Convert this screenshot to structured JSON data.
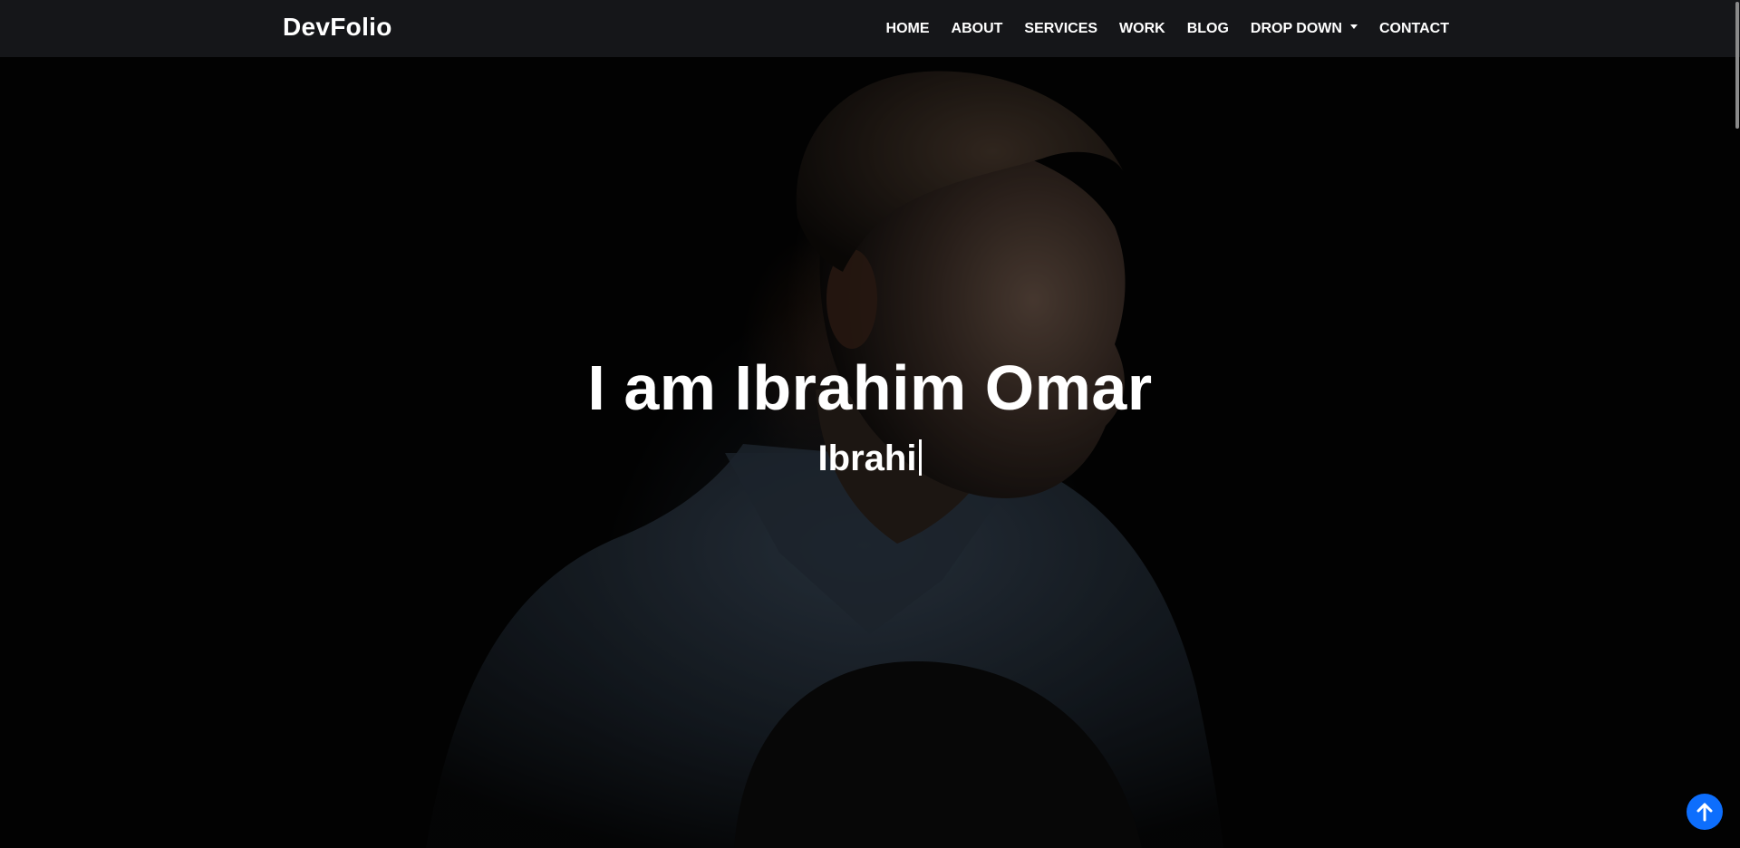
{
  "brand": "DevFolio",
  "nav": {
    "items": [
      {
        "label": "Home"
      },
      {
        "label": "About"
      },
      {
        "label": "Services"
      },
      {
        "label": "Work"
      },
      {
        "label": "Blog"
      },
      {
        "label": "Drop Down"
      },
      {
        "label": "Contact"
      }
    ],
    "dropdown_icon": "caret-down-icon"
  },
  "hero": {
    "title": "I am Ibrahim Omar",
    "typed_text": "Ibrahi"
  },
  "back_to_top": {
    "icon": "arrow-up-icon",
    "color": "#0d6efd"
  },
  "colors": {
    "navbar_bg": "#16171a",
    "text": "#ffffff",
    "accent": "#0d6efd"
  }
}
